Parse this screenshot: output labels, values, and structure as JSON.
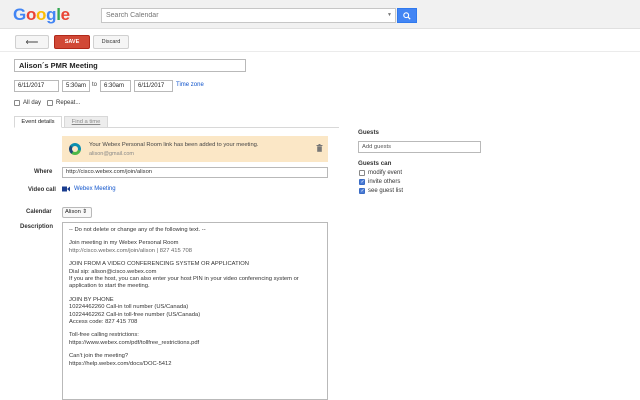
{
  "header": {
    "logo_letters": [
      "G",
      "o",
      "o",
      "g",
      "l",
      "e"
    ],
    "logo_colors": [
      "#4285f4",
      "#ea4335",
      "#fbbc05",
      "#4285f4",
      "#34a853",
      "#ea4335"
    ],
    "search_placeholder": "Search Calendar",
    "search_icon": "search-icon"
  },
  "toolbar": {
    "back_label": "⟵",
    "save_label": "SAVE",
    "discard_label": "Discard"
  },
  "event": {
    "title": "Alison´s PMR Meeting",
    "start_date": "6/11/2017",
    "start_time": "5:30am",
    "to_label": "to",
    "end_time": "6:30am",
    "end_date": "6/11/2017",
    "timezone_label": "Time zone",
    "all_day_label": "All day",
    "repeat_label": "Repeat..."
  },
  "tabs": {
    "details": "Event details",
    "find_time": "Find a time"
  },
  "banner": {
    "message": "Your Webex Personal Room link has been added to your meeting.",
    "email": "alison@gmail.com"
  },
  "fields": {
    "where_label": "Where",
    "where_value": "http://cisco.webex.com/join/alison",
    "video_label": "Video call",
    "video_link": "Webex Meeting",
    "calendar_label": "Calendar",
    "calendar_value": "Alison ⇕",
    "description_label": "Description"
  },
  "description": {
    "line1": "-- Do not delete or change any of the following text. --",
    "line2": "Join meeting in my Webex Personal Room",
    "line3": "http://cisco.webex.com/join/alison  |  827 415 708",
    "line4": "JOIN FROM A VIDEO CONFERENCING SYSTEM OR APPLICATION",
    "line5": "Dial sip: alison@cisco.webex.com",
    "line6": "If you are the host, you can also enter your host PIN in your video conferencing system or",
    "line7": "application to start the meeting.",
    "line8": "JOIN BY PHONE",
    "line9": "10224462260 Call-in toll number (US/Canada)",
    "line10": "10224462262 Call-in toll-free number (US/Canada)",
    "line11": "Access code: 827 415 708",
    "line12": "Toll-free calling restrictions:",
    "line13": "https://www.webex.com/pdf/tollfree_restrictions.pdf",
    "line14": "Can't join the meeting?",
    "line15": "https://help.webex.com/docs/DOC-5412"
  },
  "guests": {
    "heading": "Guests",
    "placeholder": "Add guests",
    "can_heading": "Guests can",
    "perm1": "modify event",
    "perm2": "invite others",
    "perm3": "see guest list",
    "perm1_checked": false,
    "perm2_checked": true,
    "perm3_checked": true
  }
}
